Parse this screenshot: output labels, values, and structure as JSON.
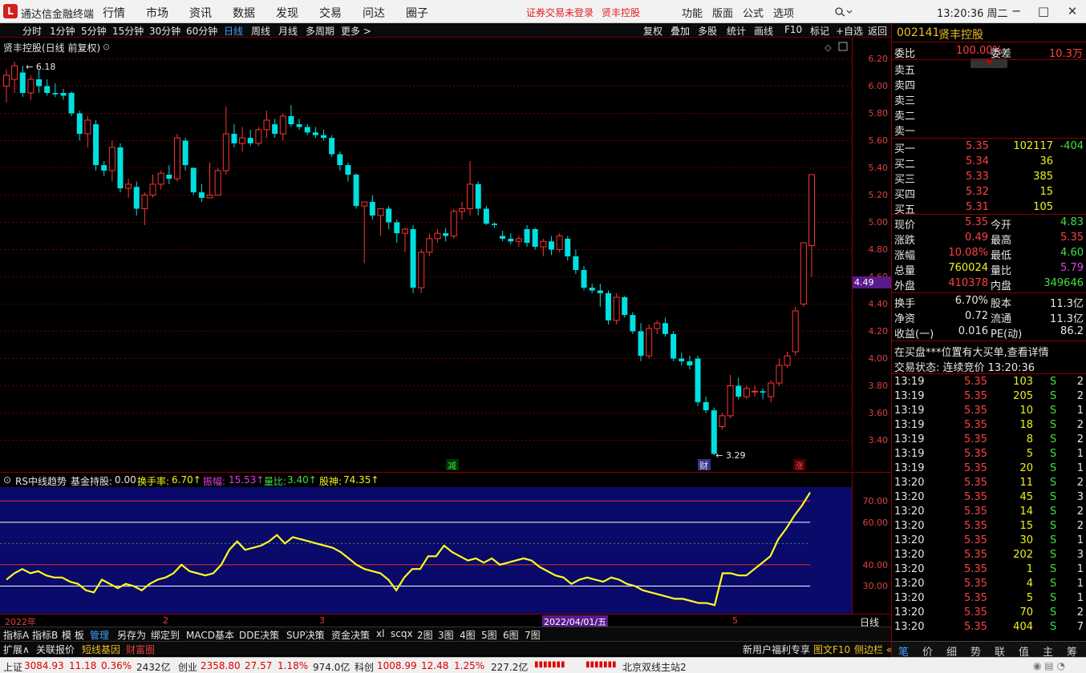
{
  "app": {
    "title": "通达信金融终端",
    "menu": [
      "行情",
      "市场",
      "资讯",
      "数据",
      "发现",
      "交易",
      "问达",
      "圈子"
    ],
    "notice": "证券交易未登录",
    "notice_stock": "贤丰控股",
    "right_menu": [
      "功能",
      "版面",
      "公式",
      "选项"
    ],
    "clock": "13:20:36 周二"
  },
  "period_bar": {
    "items": [
      "分时",
      "1分钟",
      "5分钟",
      "15分钟",
      "30分钟",
      "60分钟",
      "日线",
      "周线",
      "月线",
      "多周期",
      "更多 >"
    ],
    "active": "日线",
    "tools": [
      "复权",
      "叠加",
      "多股",
      "统计",
      "画线",
      "F10",
      "标记",
      "+自选",
      "返回"
    ]
  },
  "chart": {
    "title": "贤丰控股(日线 前复权)",
    "high_label": "6.18",
    "low_label": "3.29",
    "yticks": [
      "6.20",
      "6.00",
      "5.80",
      "5.60",
      "5.40",
      "5.20",
      "5.00",
      "4.80",
      "4.60",
      "4.40",
      "4.20",
      "4.00",
      "3.80",
      "3.60",
      "3.40"
    ],
    "current_price_tag": "4.49",
    "markers": [
      "减",
      "财",
      "涨"
    ]
  },
  "indicator": {
    "name": "RS中线趋势",
    "items": [
      {
        "label": "基金持股:",
        "value": "0.00",
        "color": "#e6e6e6"
      },
      {
        "label": "换手率:",
        "value": "6.70↑",
        "color": "#f0f020"
      },
      {
        "label": "振幅:",
        "value": "15.53↑",
        "color": "#e040e0"
      },
      {
        "label": "量比:",
        "value": "3.40↑",
        "color": "#40e040"
      },
      {
        "label": "股神:",
        "value": "74.35↑",
        "color": "#f0f020"
      }
    ],
    "yticks": [
      "70.00",
      "60.00",
      "40.00",
      "30.00"
    ]
  },
  "date_axis": {
    "labels": [
      "2022年",
      "2",
      "3",
      "2022/04/01/五",
      "5"
    ],
    "period": "日线"
  },
  "bottom_tabs": [
    "指标A",
    "指标B",
    "模 板",
    "管理",
    "另存为",
    "绑定到",
    "MACD基本",
    "DDE决策",
    "SUP决策",
    "资金决策",
    "xl",
    "scqx",
    "2图",
    "3图",
    "4图",
    "5图",
    "6图",
    "7图"
  ],
  "sub_tabs": [
    {
      "label": "扩展∧",
      "color": "#e6e6e6"
    },
    {
      "label": "关联报价",
      "color": "#e6e6e6"
    },
    {
      "label": "短线基因",
      "color": "#f0c020"
    },
    {
      "label": "财富圈",
      "color": "#e04040"
    }
  ],
  "sub_right": [
    "新用户福利专享",
    "图文F10",
    "侧边栏 «"
  ],
  "status_bar": {
    "items": [
      {
        "name": "上证",
        "price": "3084.93",
        "chg": "11.18",
        "pct": "0.36%",
        "amt": "2432亿"
      },
      {
        "name": "创业",
        "price": "2358.80",
        "chg": "27.57",
        "pct": "1.18%",
        "amt": "974.0亿"
      },
      {
        "name": "科创",
        "price": "1008.99",
        "chg": "12.48",
        "pct": "1.25%",
        "amt": "227.2亿"
      }
    ],
    "server": "北京双线主站2"
  },
  "quote": {
    "code": "002141",
    "name": "贤丰控股",
    "weibi_label": "委比",
    "weibi": "100.00%",
    "weicha_label": "委差",
    "weicha": "10.3万",
    "asks": [
      {
        "label": "卖五",
        "price": "",
        "vol": ""
      },
      {
        "label": "卖四",
        "price": "",
        "vol": ""
      },
      {
        "label": "卖三",
        "price": "",
        "vol": ""
      },
      {
        "label": "卖二",
        "price": "",
        "vol": ""
      },
      {
        "label": "卖一",
        "price": "",
        "vol": ""
      }
    ],
    "bids": [
      {
        "label": "买一",
        "price": "5.35",
        "vol": "102117",
        "chg": "-404"
      },
      {
        "label": "买二",
        "price": "5.34",
        "vol": "36",
        "chg": ""
      },
      {
        "label": "买三",
        "price": "5.33",
        "vol": "385",
        "chg": ""
      },
      {
        "label": "买四",
        "price": "5.32",
        "vol": "15",
        "chg": ""
      },
      {
        "label": "买五",
        "price": "5.31",
        "vol": "105",
        "chg": ""
      }
    ],
    "stats": [
      {
        "l1": "现价",
        "v1": "5.35",
        "c1": "#ff4040",
        "l2": "今开",
        "v2": "4.83",
        "c2": "#40e040"
      },
      {
        "l1": "涨跌",
        "v1": "0.49",
        "c1": "#ff4040",
        "l2": "最高",
        "v2": "5.35",
        "c2": "#ff4040"
      },
      {
        "l1": "涨幅",
        "v1": "10.08%",
        "c1": "#ff4040",
        "l2": "最低",
        "v2": "4.60",
        "c2": "#40e040"
      },
      {
        "l1": "总量",
        "v1": "760024",
        "c1": "#f0f020",
        "l2": "量比",
        "v2": "5.79",
        "c2": "#e040e0"
      },
      {
        "l1": "外盘",
        "v1": "410378",
        "c1": "#ff4040",
        "l2": "内盘",
        "v2": "349646",
        "c2": "#40e040"
      }
    ],
    "stats2": [
      {
        "l1": "换手",
        "v1": "6.70%",
        "l2": "股本",
        "v2": "11.3亿"
      },
      {
        "l1": "净资",
        "v1": "0.72",
        "l2": "流通",
        "v2": "11.3亿"
      },
      {
        "l1": "收益(一)",
        "v1": "0.016",
        "l2": "PE(动)",
        "v2": "86.2"
      }
    ],
    "alert": "在买盘***位置有大买单,查看详情",
    "trade_state": "交易状态: 连续竞价 13:20:36",
    "ticks": [
      {
        "t": "13:19",
        "p": "5.35",
        "v": "103",
        "s": "S",
        "n": "2"
      },
      {
        "t": "13:19",
        "p": "5.35",
        "v": "205",
        "s": "S",
        "n": "2"
      },
      {
        "t": "13:19",
        "p": "5.35",
        "v": "10",
        "s": "S",
        "n": "1"
      },
      {
        "t": "13:19",
        "p": "5.35",
        "v": "18",
        "s": "S",
        "n": "2"
      },
      {
        "t": "13:19",
        "p": "5.35",
        "v": "8",
        "s": "S",
        "n": "2"
      },
      {
        "t": "13:19",
        "p": "5.35",
        "v": "5",
        "s": "S",
        "n": "1"
      },
      {
        "t": "13:19",
        "p": "5.35",
        "v": "20",
        "s": "S",
        "n": "1"
      },
      {
        "t": "13:20",
        "p": "5.35",
        "v": "11",
        "s": "S",
        "n": "2"
      },
      {
        "t": "13:20",
        "p": "5.35",
        "v": "45",
        "s": "S",
        "n": "3"
      },
      {
        "t": "13:20",
        "p": "5.35",
        "v": "14",
        "s": "S",
        "n": "2"
      },
      {
        "t": "13:20",
        "p": "5.35",
        "v": "15",
        "s": "S",
        "n": "2"
      },
      {
        "t": "13:20",
        "p": "5.35",
        "v": "30",
        "s": "S",
        "n": "1"
      },
      {
        "t": "13:20",
        "p": "5.35",
        "v": "202",
        "s": "S",
        "n": "3"
      },
      {
        "t": "13:20",
        "p": "5.35",
        "v": "1",
        "s": "S",
        "n": "1"
      },
      {
        "t": "13:20",
        "p": "5.35",
        "v": "4",
        "s": "S",
        "n": "1"
      },
      {
        "t": "13:20",
        "p": "5.35",
        "v": "5",
        "s": "S",
        "n": "1"
      },
      {
        "t": "13:20",
        "p": "5.35",
        "v": "70",
        "s": "S",
        "n": "2"
      },
      {
        "t": "13:20",
        "p": "5.35",
        "v": "404",
        "s": "S",
        "n": "7"
      }
    ],
    "panel_tabs": [
      "笔",
      "价",
      "细",
      "势",
      "联",
      "值",
      "主",
      "筹"
    ]
  },
  "chart_data": {
    "type": "candlestick",
    "title": "贤丰控股(日线 前复权)",
    "ylim": [
      3.25,
      6.25
    ],
    "ohlc": [
      [
        6.0,
        6.12,
        5.88,
        6.08
      ],
      [
        6.05,
        6.18,
        5.95,
        6.15
      ],
      [
        6.1,
        6.15,
        5.92,
        5.95
      ],
      [
        5.95,
        6.08,
        5.9,
        6.05
      ],
      [
        6.05,
        6.12,
        5.95,
        6.0
      ],
      [
        6.0,
        6.05,
        5.93,
        5.95
      ],
      [
        5.95,
        6.02,
        5.92,
        5.94
      ],
      [
        5.95,
        5.98,
        5.9,
        5.93
      ],
      [
        5.95,
        5.96,
        5.78,
        5.8
      ],
      [
        5.8,
        5.82,
        5.6,
        5.65
      ],
      [
        5.65,
        5.78,
        5.55,
        5.75
      ],
      [
        5.72,
        5.75,
        5.38,
        5.42
      ],
      [
        5.42,
        5.45,
        5.34,
        5.38
      ],
      [
        5.38,
        5.6,
        5.3,
        5.55
      ],
      [
        5.55,
        5.58,
        5.22,
        5.25
      ],
      [
        5.25,
        5.32,
        5.18,
        5.28
      ],
      [
        5.26,
        5.3,
        5.05,
        5.1
      ],
      [
        5.1,
        5.22,
        4.98,
        5.2
      ],
      [
        5.2,
        5.35,
        5.18,
        5.28
      ],
      [
        5.28,
        5.38,
        5.24,
        5.36
      ],
      [
        5.35,
        5.42,
        5.28,
        5.32
      ],
      [
        5.32,
        5.65,
        5.3,
        5.62
      ],
      [
        5.6,
        5.62,
        5.38,
        5.42
      ],
      [
        5.4,
        5.4,
        5.2,
        5.22
      ],
      [
        5.22,
        5.28,
        5.15,
        5.18
      ],
      [
        5.18,
        5.44,
        5.18,
        5.2
      ],
      [
        5.2,
        5.4,
        5.2,
        5.38
      ],
      [
        5.38,
        5.85,
        5.35,
        5.65
      ],
      [
        5.65,
        5.72,
        5.55,
        5.58
      ],
      [
        5.58,
        5.7,
        5.52,
        5.62
      ],
      [
        5.62,
        5.68,
        5.56,
        5.58
      ],
      [
        5.58,
        5.7,
        5.56,
        5.68
      ],
      [
        5.68,
        5.82,
        5.62,
        5.75
      ],
      [
        5.72,
        5.76,
        5.62,
        5.65
      ],
      [
        5.65,
        5.8,
        5.6,
        5.78
      ],
      [
        5.78,
        5.86,
        5.7,
        5.72
      ],
      [
        5.72,
        5.76,
        5.68,
        5.7
      ],
      [
        5.7,
        5.72,
        5.64,
        5.66
      ],
      [
        5.66,
        5.7,
        5.62,
        5.64
      ],
      [
        5.64,
        5.68,
        5.6,
        5.62
      ],
      [
        5.62,
        5.64,
        5.48,
        5.5
      ],
      [
        5.5,
        5.52,
        5.38,
        5.42
      ],
      [
        5.42,
        5.44,
        5.3,
        5.35
      ],
      [
        5.35,
        5.36,
        5.1,
        5.12
      ],
      [
        5.12,
        5.15,
        4.7,
        5.15
      ],
      [
        5.15,
        5.2,
        5.02,
        5.05
      ],
      [
        5.05,
        5.1,
        4.9,
        5.1
      ],
      [
        5.1,
        5.12,
        4.95,
        5.0
      ],
      [
        5.0,
        5.02,
        4.85,
        4.92
      ],
      [
        4.92,
        4.96,
        4.78,
        4.95
      ],
      [
        4.95,
        4.98,
        4.48,
        4.52
      ],
      [
        4.52,
        4.8,
        4.48,
        4.78
      ],
      [
        4.78,
        4.92,
        4.75,
        4.88
      ],
      [
        4.88,
        4.95,
        4.85,
        4.92
      ],
      [
        4.92,
        4.96,
        4.86,
        4.9
      ],
      [
        4.9,
        5.1,
        4.88,
        5.08
      ],
      [
        5.08,
        5.15,
        5.02,
        5.1
      ],
      [
        5.1,
        5.45,
        5.05,
        5.28
      ],
      [
        5.28,
        5.3,
        5.05,
        5.1
      ],
      [
        5.1,
        5.12,
        4.98,
        4.99
      ],
      [
        4.99,
        5.0,
        4.96,
        4.98
      ],
      [
        4.9,
        4.94,
        4.86,
        4.88
      ],
      [
        4.88,
        4.92,
        4.84,
        4.86
      ],
      [
        4.86,
        4.9,
        4.82,
        4.88
      ],
      [
        4.95,
        4.98,
        4.82,
        4.85
      ],
      [
        4.95,
        4.96,
        4.8,
        4.82
      ],
      [
        4.82,
        4.88,
        4.75,
        4.86
      ],
      [
        4.86,
        4.9,
        4.76,
        4.8
      ],
      [
        4.8,
        4.92,
        4.78,
        4.9
      ],
      [
        4.88,
        4.9,
        4.72,
        4.75
      ],
      [
        4.75,
        4.8,
        4.62,
        4.65
      ],
      [
        4.65,
        4.68,
        4.5,
        4.52
      ],
      [
        4.52,
        4.55,
        4.48,
        4.5
      ],
      [
        4.5,
        4.55,
        4.38,
        4.48
      ],
      [
        4.48,
        4.5,
        4.25,
        4.28
      ],
      [
        4.28,
        4.48,
        4.25,
        4.45
      ],
      [
        4.45,
        4.46,
        4.3,
        4.32
      ],
      [
        4.32,
        4.34,
        4.18,
        4.2
      ],
      [
        4.2,
        4.26,
        3.98,
        4.02
      ],
      [
        4.02,
        4.25,
        4.0,
        4.22
      ],
      [
        4.22,
        4.28,
        4.18,
        4.26
      ],
      [
        4.26,
        4.3,
        4.16,
        4.18
      ],
      [
        4.18,
        4.2,
        3.98,
        4.0
      ],
      [
        4.0,
        4.04,
        3.95,
        3.98
      ],
      [
        3.98,
        4.02,
        3.92,
        3.95
      ],
      [
        4.0,
        4.02,
        3.65,
        3.68
      ],
      [
        3.68,
        3.72,
        3.6,
        3.62
      ],
      [
        3.62,
        3.64,
        3.29,
        3.3
      ],
      [
        3.5,
        3.6,
        3.48,
        3.58
      ],
      [
        3.58,
        3.88,
        3.56,
        3.8
      ],
      [
        3.8,
        3.86,
        3.7,
        3.72
      ],
      [
        3.72,
        3.8,
        3.7,
        3.78
      ],
      [
        3.76,
        3.8,
        3.72,
        3.76
      ],
      [
        3.76,
        3.78,
        3.7,
        3.75
      ],
      [
        3.72,
        3.84,
        3.68,
        3.82
      ],
      [
        3.82,
        4.0,
        3.8,
        3.95
      ],
      [
        3.95,
        4.05,
        3.93,
        4.02
      ],
      [
        4.05,
        4.38,
        4.02,
        4.35
      ],
      [
        4.4,
        4.85,
        4.38,
        4.85
      ],
      [
        4.83,
        5.35,
        4.6,
        5.35
      ]
    ],
    "indicator_series": {
      "name": "RS中线趋势",
      "ylim": [
        20,
        75
      ],
      "reference_lines": [
        70,
        60,
        50,
        40,
        30
      ],
      "values": [
        33,
        36,
        38,
        36,
        37,
        35,
        34,
        34,
        32,
        31,
        28,
        27,
        33,
        31,
        29,
        31,
        30,
        28,
        31,
        33,
        34,
        36,
        40,
        37,
        36,
        35,
        36,
        40,
        47,
        51,
        47,
        48,
        49,
        51,
        54,
        50,
        53,
        52,
        51,
        50,
        49,
        48,
        46,
        43,
        40,
        38,
        37,
        36,
        33,
        28,
        34,
        38,
        38,
        44,
        44,
        49,
        46,
        44,
        42,
        43,
        41,
        43,
        40,
        41,
        42,
        43,
        42,
        39,
        37,
        35,
        34,
        31,
        33,
        34,
        33,
        32,
        34,
        33,
        31,
        30,
        28,
        27,
        26,
        25,
        24,
        24,
        23,
        22,
        22,
        21,
        36,
        36,
        35,
        35,
        38,
        41,
        44,
        52,
        57,
        63,
        68,
        74
      ]
    }
  }
}
